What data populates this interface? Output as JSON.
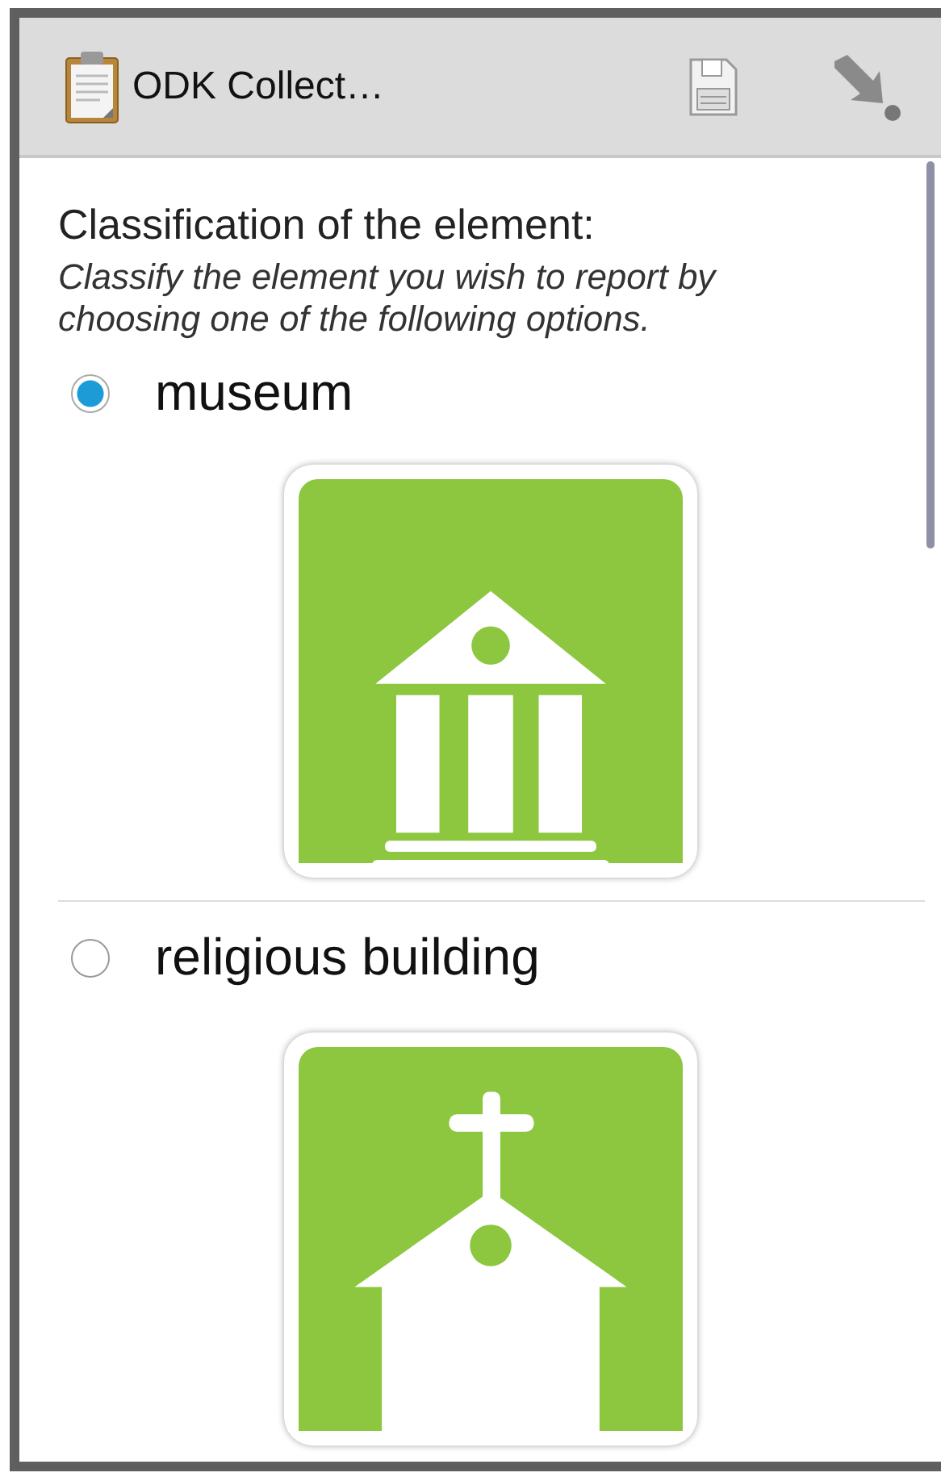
{
  "app_bar": {
    "title": "ODK Collect…"
  },
  "question": {
    "label": "Classification of the element:",
    "hint": "Classify the element you wish to report by choosing one of the following options."
  },
  "options": [
    {
      "label": "museum",
      "selected": true,
      "kind": "museum"
    },
    {
      "label": "religious building",
      "selected": false,
      "kind": "church"
    }
  ]
}
